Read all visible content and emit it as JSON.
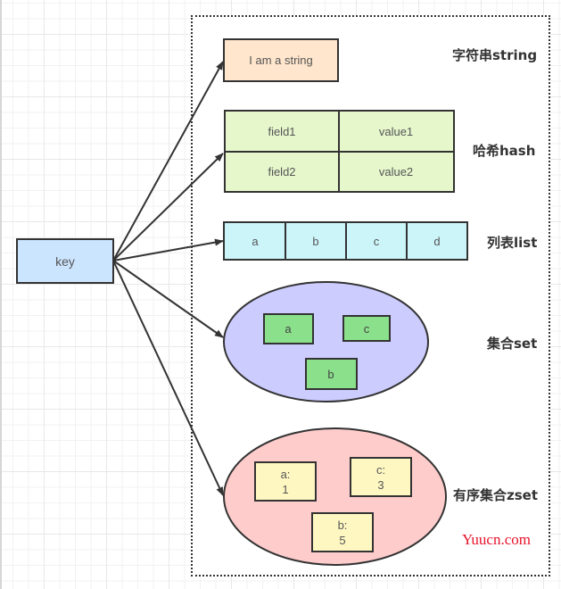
{
  "key": {
    "label": "key",
    "fill": "#cce5ff"
  },
  "string": {
    "value": "I am a string",
    "fill": "#ffe6cc",
    "type_label": "字符串string"
  },
  "hash": {
    "fill": "#e6f7cc",
    "type_label": "哈希hash",
    "rows": [
      {
        "field": "field1",
        "value": "value1"
      },
      {
        "field": "field2",
        "value": "value2"
      }
    ]
  },
  "list": {
    "fill": "#ccf5fa",
    "type_label": "列表list",
    "items": [
      "a",
      "b",
      "c",
      "d"
    ]
  },
  "set": {
    "fill": "#ccccff",
    "item_fill": "#8be08b",
    "type_label": "集合set",
    "items": [
      "a",
      "c",
      "b"
    ]
  },
  "zset": {
    "fill": "#ffcccc",
    "item_fill": "#fff7c2",
    "type_label": "有序集合zset",
    "items": [
      {
        "member": "a:",
        "score": "1"
      },
      {
        "member": "c:",
        "score": "3"
      },
      {
        "member": "b:",
        "score": "5"
      }
    ]
  },
  "watermark": "Yuucn.com",
  "colors": {
    "stroke": "#333333",
    "text": "#555555"
  }
}
